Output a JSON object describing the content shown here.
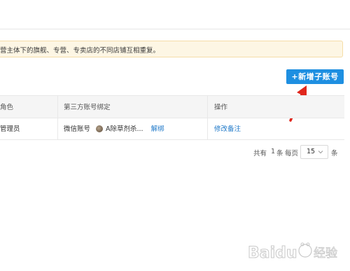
{
  "notice": {
    "text": "营主体下的旗舰、专营、专卖店的不同店铺互相重复。"
  },
  "actions": {
    "add_sub_account": "+新增子账号"
  },
  "table": {
    "headers": {
      "role": "角色",
      "third_party": "第三方账号绑定",
      "operation": "操作"
    },
    "rows": [
      {
        "role": "管理员",
        "bind_type": "微信账号",
        "bind_name": "A除草剂杀...",
        "unbind": "解绑",
        "edit_note": "修改备注"
      }
    ]
  },
  "pagination": {
    "total_prefix": "共有",
    "total_count": "1",
    "total_suffix": "条",
    "per_page_label": "每页",
    "page_size": "15",
    "per_page_suffix": "条"
  },
  "watermark": {
    "text": "Baidu经验"
  },
  "colors": {
    "primary": "#1e8fe1",
    "link": "#1e78c8",
    "notice_bg": "#fdf6e4",
    "arrow": "#e0261c"
  }
}
